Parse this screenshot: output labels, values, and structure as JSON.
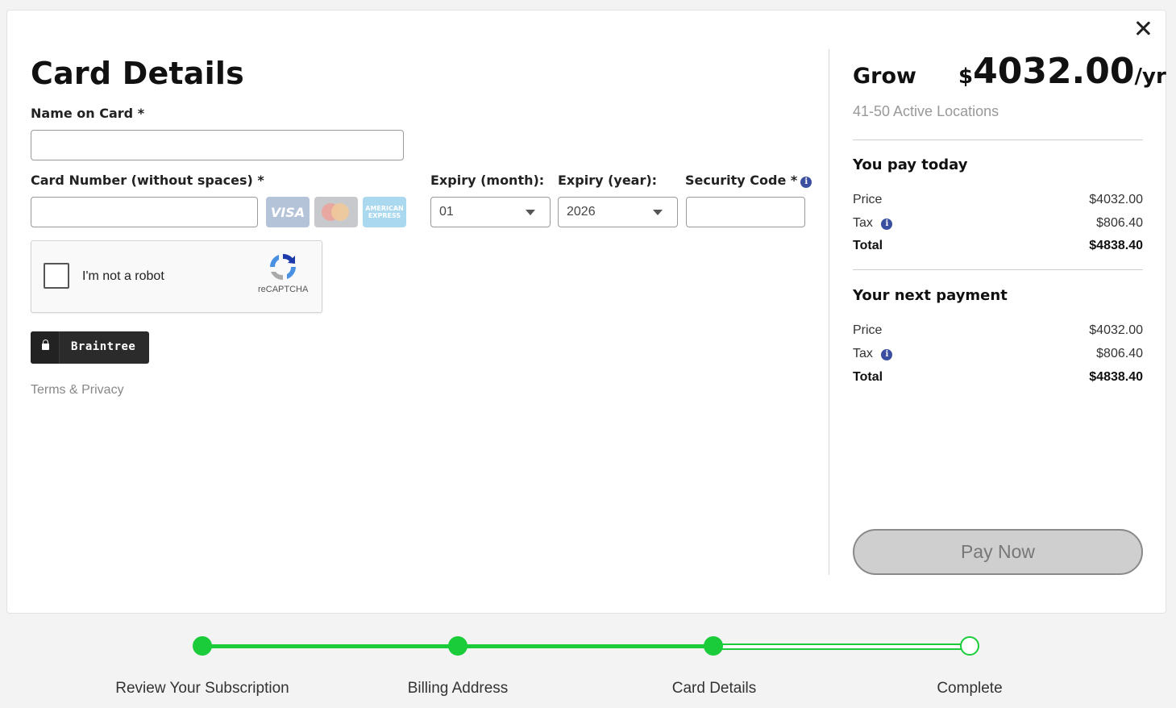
{
  "title": "Card Details",
  "form": {
    "name_label": "Name on Card *",
    "name_value": "",
    "card_label": "Card Number (without spaces) *",
    "card_value": "",
    "card_logos": {
      "visa": "VISA",
      "amex": "AMERICAN EXPRESS"
    },
    "expiry_month_label": "Expiry (month):",
    "expiry_month_value": "01",
    "expiry_year_label": "Expiry (year):",
    "expiry_year_value": "2026",
    "security_label": "Security Code *",
    "security_value": ""
  },
  "recaptcha": {
    "label": "I'm not a robot",
    "brand": "reCAPTCHA"
  },
  "braintree_label": "Braintree",
  "terms_label": "Terms & Privacy",
  "summary": {
    "plan_name": "Grow",
    "currency": "$",
    "amount": "4032.00",
    "period": "/yr",
    "locations": "41-50 Active Locations",
    "today": {
      "title": "You pay today",
      "price_label": "Price",
      "price": "$4032.00",
      "tax_label": "Tax",
      "tax": "$806.40",
      "total_label": "Total",
      "total": "$4838.40"
    },
    "next": {
      "title": "Your next payment",
      "price_label": "Price",
      "price": "$4032.00",
      "tax_label": "Tax",
      "tax": "$806.40",
      "total_label": "Total",
      "total": "$4838.40"
    },
    "pay_label": "Pay Now"
  },
  "steps": [
    {
      "label": "Review Your Subscription",
      "status": "done"
    },
    {
      "label": "Billing Address",
      "status": "done"
    },
    {
      "label": "Card Details",
      "status": "current"
    },
    {
      "label": "Complete",
      "status": "pending"
    }
  ],
  "colors": {
    "accent": "#1bcc3a",
    "info": "#3b4fa0"
  }
}
